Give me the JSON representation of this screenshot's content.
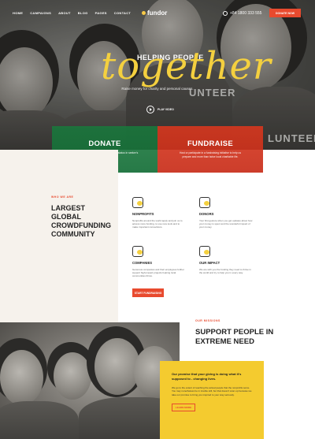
{
  "header": {
    "nav": [
      "HOME",
      "CAMPAIGNS",
      "ABOUT",
      "BLOG",
      "PAGES",
      "CONTACT"
    ],
    "logo": "fundor",
    "phone": "+84 1800 333 555",
    "donate_label": "DONATE NOW"
  },
  "hero": {
    "kicker": "HELPING PEOPLE",
    "script": "together",
    "subtitle": "Raise money for charity and personal causes.",
    "play_label": "PLAY VIDEO",
    "shirt_text_left": "UNTEER",
    "shirt_text_right": "LUNTEER"
  },
  "cta": {
    "donate": {
      "title": "DONATE",
      "text": "Support those who are social and social status in seeker's vulnerabilities."
    },
    "fundraise": {
      "title": "FUNDRAISE",
      "text": "Host or participate in a fundraising initiative to help us prepare and more than twice local charitable life."
    }
  },
  "who": {
    "label": "WHO WE ARE",
    "title_lines": [
      "LARGEST GLOBAL",
      "CROWDFUNDING",
      "COMMUNITY"
    ]
  },
  "features": [
    {
      "title": "NONPROFITS",
      "text": "Nonprofits around the world apply and join us to access more funding, to use new tools and to make important connections."
    },
    {
      "title": "DONORS",
      "text": "Your first gesture when you get updates about how your money is spent and the wonderful impact of your money."
    },
    {
      "title": "COMPANIES",
      "text": "Generous companies and their employees further support high-impact projects helping local communities thrive."
    },
    {
      "title": "OUR IMPACT",
      "text": "We are with you the funding they need to thrive in the world and try to help you in every way."
    }
  ],
  "start_label": "START FUNDRAISING",
  "mission": {
    "label": "OUR MISSIONS",
    "title_lines": [
      "SUPPORT PEOPLE IN",
      "EXTREME NEED"
    ],
    "quote": "Our promise that your giving is doing what it's supposed to - changing lives.",
    "text": "We go to the extent of reaching the actual people that the nonprofits serve. You may nonetheless be in trouble still, but that doesn't scan up because we take our promise to bring you inspired to your way seriously.",
    "learn_label": "LEARN MORE"
  },
  "colors": {
    "accent": "#e84a2e",
    "yellow": "#f4cb2f",
    "green": "#1d7a3c"
  }
}
